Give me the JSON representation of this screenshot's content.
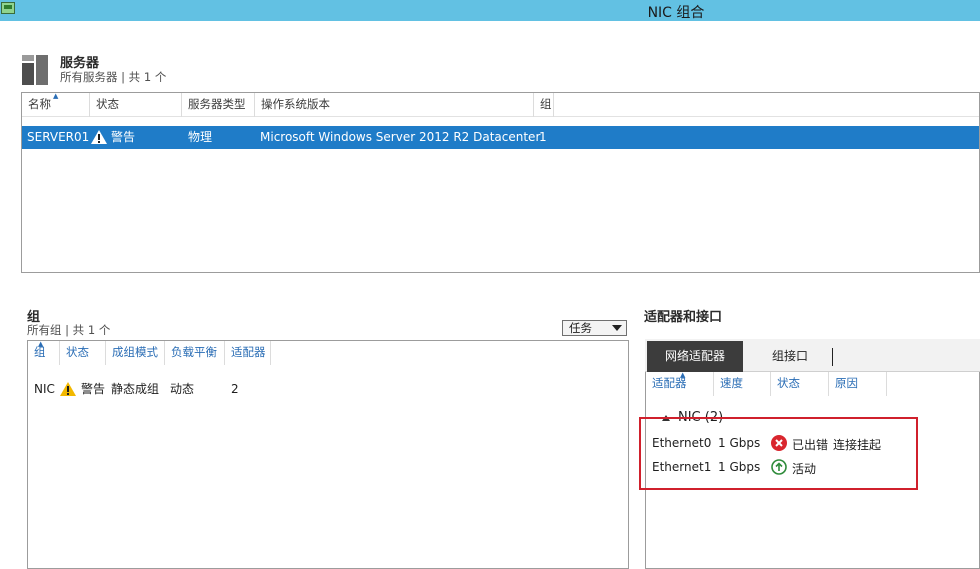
{
  "window": {
    "title": "NIC 组合"
  },
  "servers": {
    "title": "服务器",
    "subtitle": "所有服务器 | 共 1 个",
    "columns": [
      "名称",
      "状态",
      "服务器类型",
      "操作系统版本",
      "组"
    ],
    "rows": [
      {
        "name": "SERVER01",
        "status": "警告",
        "type": "物理",
        "os": "Microsoft Windows Server 2012 R2 Datacenter",
        "group": "1"
      }
    ]
  },
  "groups": {
    "title": "组",
    "subtitle": "所有组 | 共 1 个",
    "tasks_label": "任务",
    "columns": [
      "组",
      "状态",
      "成组模式",
      "负载平衡",
      "适配器"
    ],
    "rows": [
      {
        "name": "NIC",
        "status": "警告",
        "mode": "静态成组",
        "balance": "动态",
        "adapters": "2"
      }
    ]
  },
  "adapters": {
    "title": "适配器和接口",
    "tabs": [
      "网络适配器",
      "组接口"
    ],
    "columns": [
      "适配器",
      "速度",
      "状态",
      "原因"
    ],
    "group_label": "NIC (2)",
    "rows": [
      {
        "name": "Ethernet0",
        "speed": "1 Gbps",
        "status": "已出错",
        "reason": "连接挂起",
        "icon": "error-icon"
      },
      {
        "name": "Ethernet1",
        "speed": "1 Gbps",
        "status": "活动",
        "reason": "",
        "icon": "active-icon"
      }
    ]
  },
  "colors": {
    "titlebar": "#62c1e3",
    "selection": "#1f7cc8",
    "highlight": "#d0202c",
    "error": "#d9262e",
    "active": "#2e8b3a"
  }
}
